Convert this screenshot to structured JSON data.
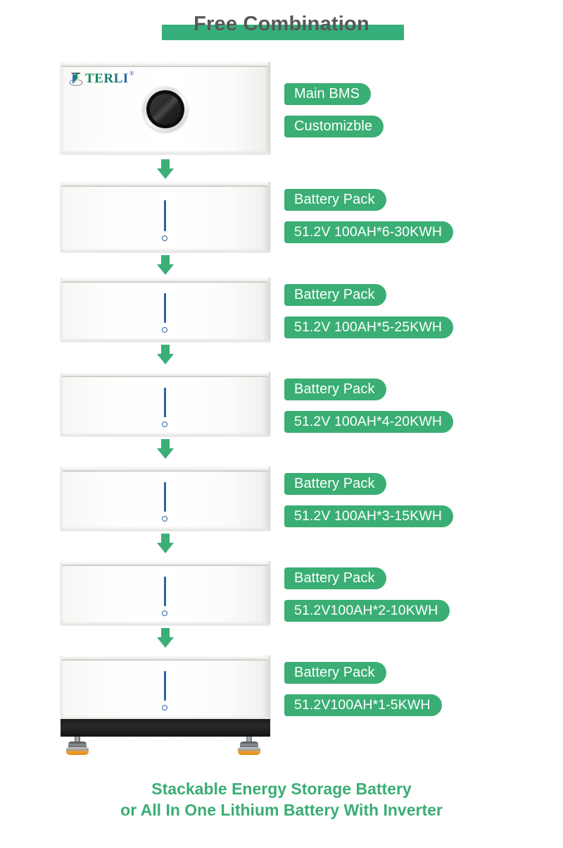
{
  "title": {
    "text": "Free Combination",
    "bar_color": "#35b07a",
    "text_color": "#58585a"
  },
  "brand": {
    "logo_text": "TERLI",
    "trademark": "®"
  },
  "colors": {
    "label_green": "#3aae74",
    "arrow_green": "#3cae78",
    "caption_green": "#3aad73",
    "indicator_blue": "#2a64a8",
    "base_black": "#1b1b1b",
    "foot_orange": "#e08a18"
  },
  "units": [
    {
      "kind": "bms",
      "labels": [
        "Main BMS",
        "Customizble"
      ]
    },
    {
      "kind": "battery",
      "labels": [
        "Battery Pack",
        "51.2V 100AH*6-30KWH"
      ]
    },
    {
      "kind": "battery",
      "labels": [
        "Battery Pack",
        "51.2V 100AH*5-25KWH"
      ]
    },
    {
      "kind": "battery",
      "labels": [
        "Battery Pack",
        "51.2V 100AH*4-20KWH"
      ]
    },
    {
      "kind": "battery",
      "labels": [
        "Battery Pack",
        "51.2V 100AH*3-15KWH"
      ]
    },
    {
      "kind": "battery",
      "labels": [
        "Battery Pack",
        "51.2V100AH*2-10KWH"
      ]
    },
    {
      "kind": "battery",
      "labels": [
        "Battery Pack",
        "51.2V100AH*1-5KWH"
      ]
    }
  ],
  "caption": {
    "line1": "Stackable Energy Storage Battery",
    "line2": "or All In One Lithium Battery With Inverter"
  }
}
